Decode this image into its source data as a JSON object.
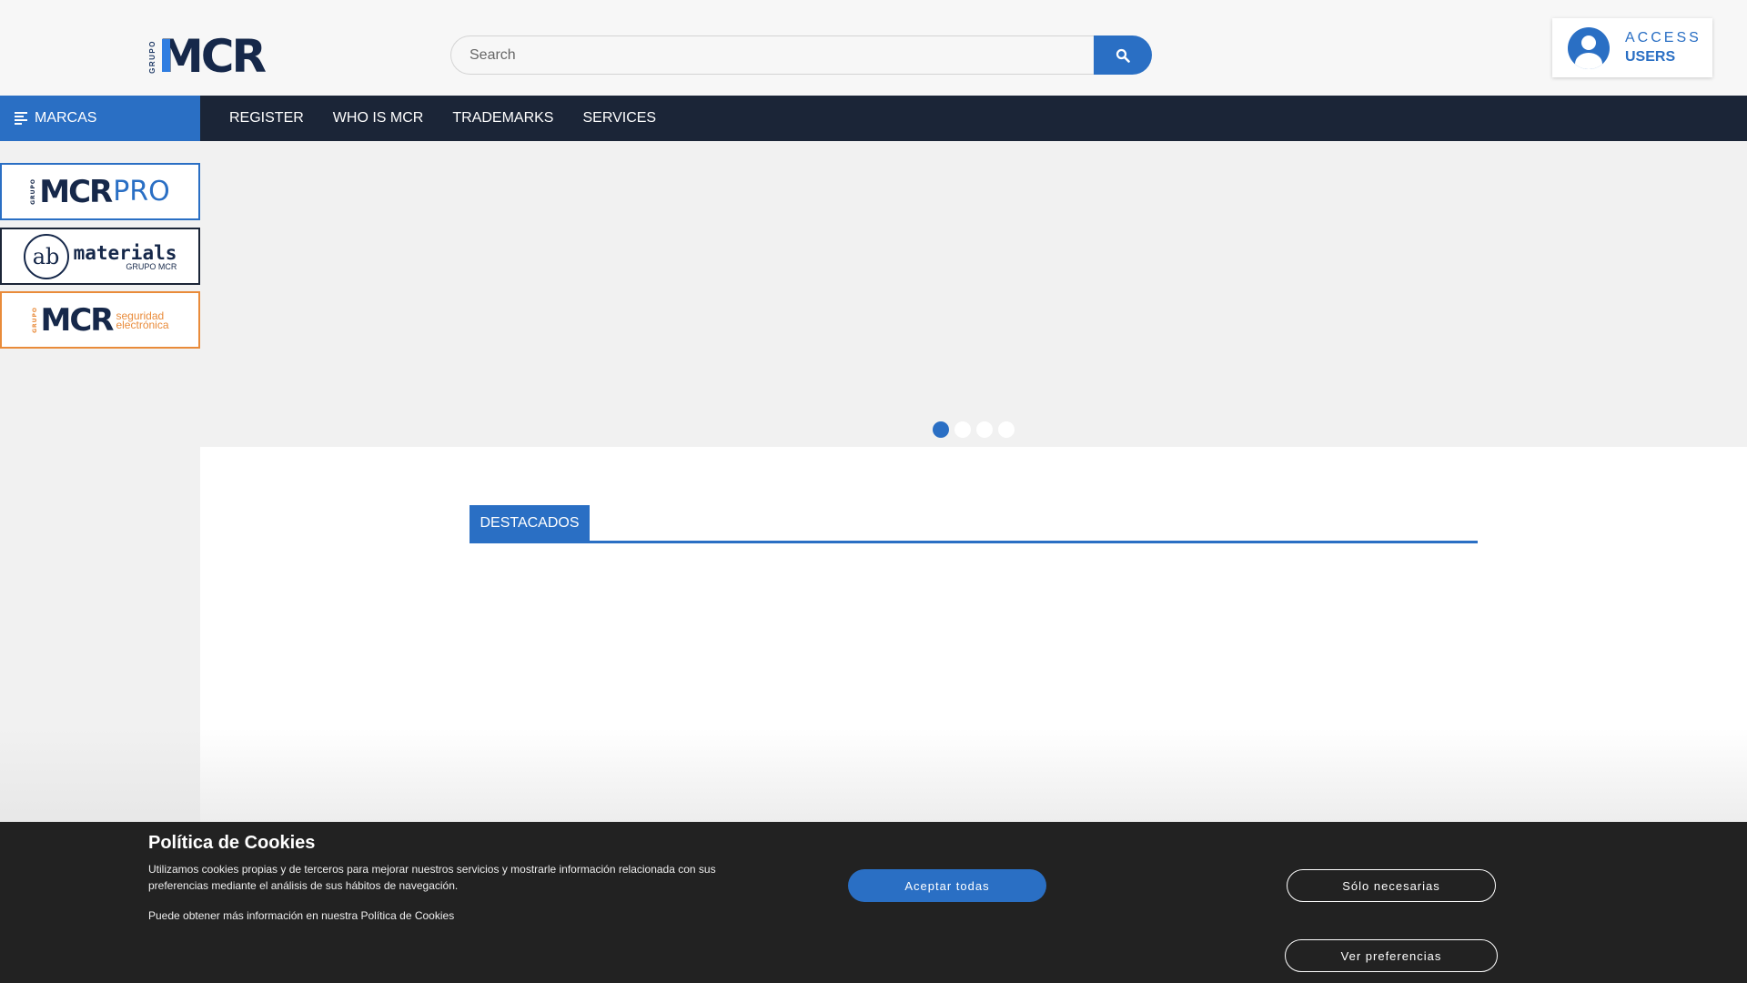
{
  "header": {
    "logo": {
      "grupo": "GRUPO",
      "mark": "MCR"
    },
    "search": {
      "placeholder": "Search"
    },
    "access": {
      "line1": "ACCESS",
      "line2": "USERS"
    }
  },
  "nav": {
    "marcas_label": "MARCAS",
    "items": [
      "REGISTER",
      "WHO IS MCR",
      "TRADEMARKS",
      "SERVICES"
    ]
  },
  "sidebar": {
    "brands": [
      {
        "grupo": "GRUPO",
        "mark": "MCR",
        "suffix": "PRO"
      },
      {
        "circle": "ab",
        "word": "materials",
        "sub": "GRUPO MCR"
      },
      {
        "grupo": "GRUPO",
        "mark": "MCR",
        "sub1": "seguridad",
        "sub2": "electrónica"
      }
    ]
  },
  "slider": {
    "dot_count": 4,
    "active_index": 0
  },
  "featured": {
    "tab_label": "DESTACADOS"
  },
  "cookie": {
    "title": "Política de Cookies",
    "text": "Utilizamos cookies propias y de terceros para mejorar nuestros servicios y mostrarle información relacionada con sus preferencias mediante el análisis de sus hábitos de navegación.",
    "more": "Puede obtener más información en nuestra Política de Cookies",
    "accept": "Aceptar todas",
    "necessary": "Sólo necesarias",
    "preferences": "Ver preferencias"
  },
  "colors": {
    "accent": "#2a6fc4",
    "nav_bg": "#1b2537",
    "orange": "#e98b3a",
    "cookie_bg": "#222222"
  }
}
